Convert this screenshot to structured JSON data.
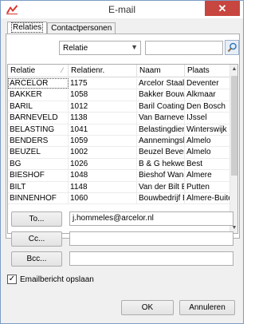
{
  "window": {
    "title": "E-mail",
    "close_glyph": "✕"
  },
  "tabs": [
    {
      "label": "Relaties",
      "active": true
    },
    {
      "label": "Contactpersonen",
      "active": false
    }
  ],
  "filter": {
    "selected": "Relatie",
    "search_value": ""
  },
  "table": {
    "columns": [
      "Relatie",
      "Relatienr.",
      "Naam",
      "Plaats"
    ],
    "rows": [
      [
        "ARCELOR",
        "1175",
        "Arcelor Staalha",
        "Deventer"
      ],
      [
        "BAKKER",
        "1058",
        "Bakker Bouw B",
        "Alkmaar"
      ],
      [
        "BARIL",
        "1012",
        "Baril Coatings B",
        "Den Bosch"
      ],
      [
        "BARNEVELD",
        "1138",
        "Van Barneveld",
        "IJssel"
      ],
      [
        "BELASTING",
        "1041",
        "Belastingdienst",
        "Winterswijk"
      ],
      [
        "BENDERS",
        "1059",
        "Aannemingsbe",
        "Almelo"
      ],
      [
        "BEUZEL",
        "1002",
        "Beuzel Bevestig",
        "Almelo"
      ],
      [
        "BG",
        "1026",
        "B & G hekwerk",
        "Best"
      ],
      [
        "BIESHOF",
        "1048",
        "Bieshof Wand-",
        "Almere"
      ],
      [
        "BILT",
        "1148",
        "Van der Bilt Ele",
        "Putten"
      ],
      [
        "BINNENHOF",
        "1060",
        "Bouwbedrijf Bir",
        "Almere-Buiten"
      ]
    ],
    "selected_row": 0
  },
  "recipients": {
    "to_label": "To...",
    "to_value": "j.hommeles@arcelor.nl",
    "cc_label": "Cc...",
    "cc_value": "",
    "bcc_label": "Bcc...",
    "bcc_value": ""
  },
  "save_option": {
    "label": "Emailbericht opslaan",
    "checked": true,
    "check_glyph": "✓"
  },
  "footer": {
    "ok_label": "OK",
    "cancel_label": "Annuleren"
  },
  "colors": {
    "close_button": "#c7463f",
    "app_icon": "#d9342b"
  }
}
